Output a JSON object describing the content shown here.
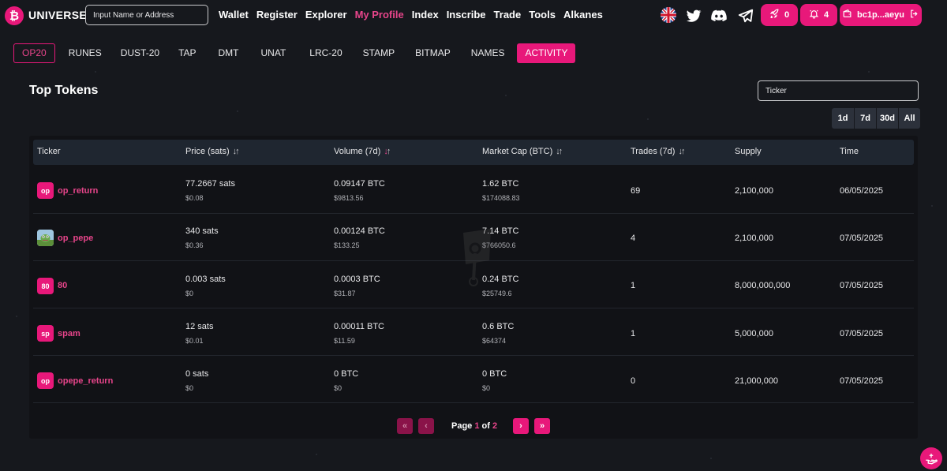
{
  "app": {
    "brand": "UNIVERSE",
    "logo_glyph": "₿"
  },
  "search": {
    "placeholder": "Input Name or Address"
  },
  "nav": [
    {
      "label": "Wallet",
      "active": false
    },
    {
      "label": "Register",
      "active": false
    },
    {
      "label": "Explorer",
      "active": false
    },
    {
      "label": "My Profile",
      "active": true
    },
    {
      "label": "Index",
      "active": false
    },
    {
      "label": "Inscribe",
      "active": false
    },
    {
      "label": "Trade",
      "active": false
    },
    {
      "label": "Tools",
      "active": false
    },
    {
      "label": "Alkanes",
      "active": false
    }
  ],
  "header_buttons": {
    "rocket_count": "0",
    "bell_count": "4",
    "wallet_address": "bc1p...aeyu"
  },
  "icons": {
    "flag": "uk-flag-icon",
    "twitter": "twitter-icon",
    "discord": "discord-icon",
    "telegram": "telegram-icon",
    "rocket": "rocket-icon",
    "bell": "bell-icon",
    "wallet": "wallet-icon",
    "logout": "logout-icon"
  },
  "protocol_tabs": [
    "OP20",
    "RUNES",
    "DUST-20",
    "TAP",
    "DMT",
    "UNAT",
    "LRC-20",
    "STAMP",
    "BITMAP",
    "NAMES",
    "ACTIVITY"
  ],
  "selected_tab": "OP20",
  "section_title": "Top Tokens",
  "ticker_filter": {
    "placeholder": "Ticker"
  },
  "periods": [
    "1d",
    "7d",
    "30d",
    "All"
  ],
  "table": {
    "columns": [
      "Ticker",
      "Price (sats)",
      "Volume (7d)",
      "Market Cap (BTC)",
      "Trades (7d)",
      "Supply",
      "Time"
    ],
    "rows": [
      {
        "icon": "op",
        "ticker": "op_return",
        "price": "77.2667 sats",
        "price_usd": "$0.08",
        "volume": "0.09147 BTC",
        "volume_usd": "$9813.56",
        "mcap": "1.62 BTC",
        "mcap_usd": "$174088.83",
        "trades": "69",
        "supply": "2,100,000",
        "time": "06/05/2025"
      },
      {
        "icon": "pepe-image",
        "ticker": "op_pepe",
        "price": "340 sats",
        "price_usd": "$0.36",
        "volume": "0.00124 BTC",
        "volume_usd": "$133.25",
        "mcap": "7.14 BTC",
        "mcap_usd": "$766050.6",
        "trades": "4",
        "supply": "2,100,000",
        "time": "07/05/2025"
      },
      {
        "icon": "80",
        "ticker": "80",
        "price": "0.003 sats",
        "price_usd": "$0",
        "volume": "0.0003 BTC",
        "volume_usd": "$31.87",
        "mcap": "0.24 BTC",
        "mcap_usd": "$25749.6",
        "trades": "1",
        "supply": "8,000,000,000",
        "time": "07/05/2025"
      },
      {
        "icon": "sp",
        "ticker": "spam",
        "price": "12 sats",
        "price_usd": "$0.01",
        "volume": "0.00011 BTC",
        "volume_usd": "$11.59",
        "mcap": "0.6 BTC",
        "mcap_usd": "$64374",
        "trades": "1",
        "supply": "5,000,000",
        "time": "07/05/2025"
      },
      {
        "icon": "op",
        "ticker": "opepe_return",
        "price": "0 sats",
        "price_usd": "$0",
        "volume": "0 BTC",
        "volume_usd": "$0",
        "mcap": "0 BTC",
        "mcap_usd": "$0",
        "trades": "0",
        "supply": "21,000,000",
        "time": "07/05/2025"
      }
    ]
  },
  "pagination": {
    "label": "Page",
    "current": "1",
    "of": "of",
    "total": "2",
    "first": "«",
    "prev": "‹",
    "next": "›",
    "last": "»"
  },
  "colors": {
    "accent": "#e8187a",
    "accent_text": "#e8458b",
    "background": "#16181d",
    "table_bg": "#111216",
    "header_bg": "#1f2630"
  }
}
